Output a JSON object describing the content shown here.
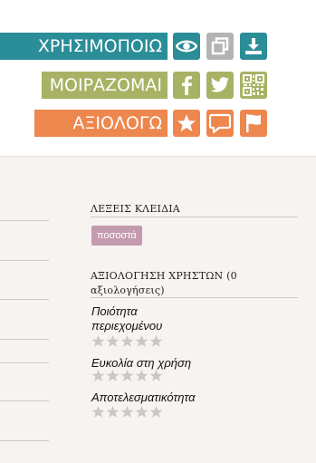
{
  "actions": {
    "use": {
      "label": "ΧΡΗΣΙΜΟΠΟΙΩ",
      "color": "#2a8d97",
      "icons": [
        "eye-icon",
        "copy-icon",
        "download-icon"
      ]
    },
    "share": {
      "label": "ΜΟΙΡΑΖΟΜΑΙ",
      "color": "#a8b264",
      "icons": [
        "facebook-icon",
        "twitter-icon",
        "qr-code-icon"
      ]
    },
    "rate": {
      "label": "ΑΞΙΟΛΟΓΩ",
      "color": "#ee874d",
      "icons": [
        "star-icon",
        "comment-icon",
        "flag-icon"
      ]
    }
  },
  "sidebar": {
    "keywords": {
      "title": "ΛΕΞΕΙΣ ΚΛΕΙΔΙΑ",
      "tags": [
        "ποσοστά"
      ]
    },
    "ratings": {
      "title": "ΑΞΙΟΛΟΓΗΣΗ ΧΡΗΣΤΩΝ (0 αξιολογήσεις)",
      "criteria": [
        {
          "label": "Ποιότητα περιεχομένου",
          "stars": 0,
          "max": 5
        },
        {
          "label": "Ευκολία στη χρήση",
          "stars": 0,
          "max": 5
        },
        {
          "label": "Αποτελεσματικότητα",
          "stars": 0,
          "max": 5
        }
      ]
    }
  },
  "colors": {
    "panel": "#f6f3f0",
    "tag": "#c49aae",
    "star_empty": "#c8c8c8"
  }
}
